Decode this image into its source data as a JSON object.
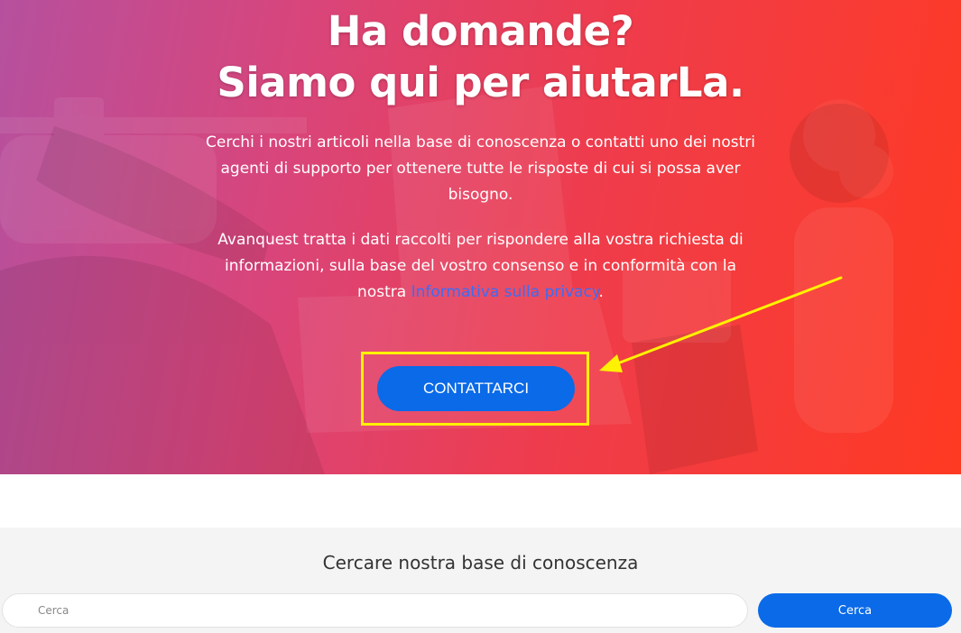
{
  "hero": {
    "title_line1": "Ha domande?",
    "title_line2": "Siamo qui per aiutarLa.",
    "intro_text": "Cerchi i nostri articoli nella base di conoscenza o contatti uno dei nostri agenti di supporto per ottenere tutte le risposte di cui si possa aver bisogno.",
    "privacy_text_before": "Avanquest tratta i dati raccolti per rispondere alla vostra richiesta di informazioni, sulla base del vostro consenso e in conformità con la nostra ",
    "privacy_link": "Informativa sulla privacy",
    "privacy_text_after": ".",
    "contact_button": "CONTATTARCI"
  },
  "annotations": {
    "highlight_color": "#fff200",
    "arrow_color": "#fff200"
  },
  "search": {
    "title": "Cercare nostra base di conoscenza",
    "placeholder": "Cerca",
    "button_label": "Cerca"
  },
  "colors": {
    "accent": "#0a6ae8",
    "hero_gradient": [
      "#b6509e",
      "#d9457a",
      "#ff3a22"
    ],
    "link": "#3b6cf5"
  }
}
